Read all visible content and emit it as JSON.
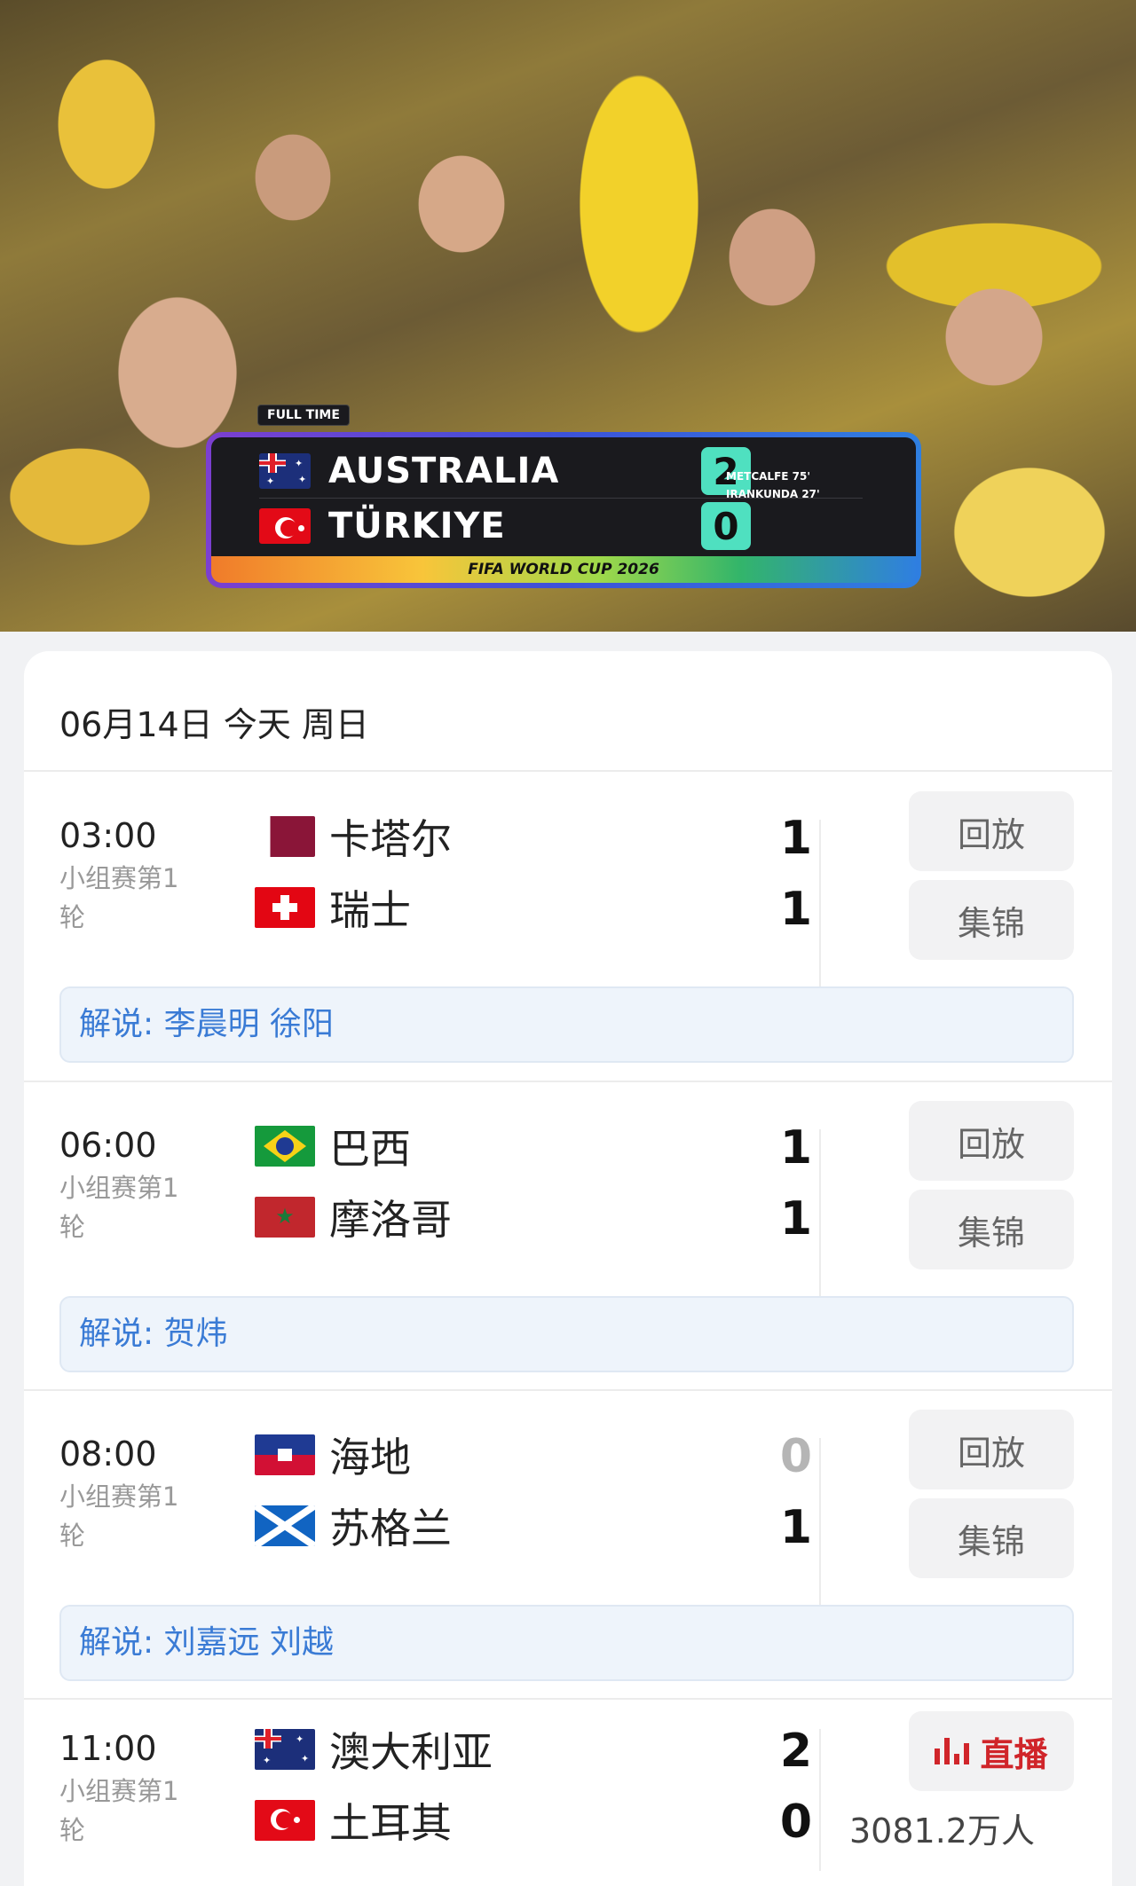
{
  "hero": {
    "tag": "FULL TIME",
    "teams": [
      {
        "name": "AUSTRALIA",
        "score": "2",
        "flag": "australia"
      },
      {
        "name": "TÜRKIYE",
        "score": "0",
        "flag": "turkey"
      }
    ],
    "scorers": [
      "METCALFE 75'",
      "IRANKUNDA 27'"
    ],
    "footer": "FIFA WORLD CUP 2026"
  },
  "schedule": {
    "date": "06月14日",
    "day": "今天",
    "weekday": "周日",
    "matches": [
      {
        "time": "03:00",
        "stage": "小组赛第1轮",
        "home": {
          "name": "卡塔尔",
          "score": "1",
          "flag": "qatar"
        },
        "away": {
          "name": "瑞士",
          "score": "1",
          "flag": "swiss"
        },
        "buttons": [
          "回放",
          "集锦"
        ],
        "commentary": "解说: 李晨明 徐阳"
      },
      {
        "time": "06:00",
        "stage": "小组赛第1轮",
        "home": {
          "name": "巴西",
          "score": "1",
          "flag": "brazil"
        },
        "away": {
          "name": "摩洛哥",
          "score": "1",
          "flag": "morocco"
        },
        "buttons": [
          "回放",
          "集锦"
        ],
        "commentary": "解说: 贺炜"
      },
      {
        "time": "08:00",
        "stage": "小组赛第1轮",
        "home": {
          "name": "海地",
          "score": "0",
          "flag": "haiti"
        },
        "away": {
          "name": "苏格兰",
          "score": "1",
          "flag": "scotland"
        },
        "buttons": [
          "回放",
          "集锦"
        ],
        "commentary": "解说: 刘嘉远 刘越"
      },
      {
        "time": "11:00",
        "stage": "小组赛第1轮",
        "home": {
          "name": "澳大利亚",
          "score": "2",
          "flag": "australia"
        },
        "away": {
          "name": "土耳其",
          "score": "0",
          "flag": "turkey"
        },
        "live_label": "直播",
        "viewers": "3081.2万人"
      }
    ]
  },
  "colors": {
    "live": "#d0252a",
    "commentary": "#3a7bd5",
    "dim_score": "#b5b5b5"
  }
}
